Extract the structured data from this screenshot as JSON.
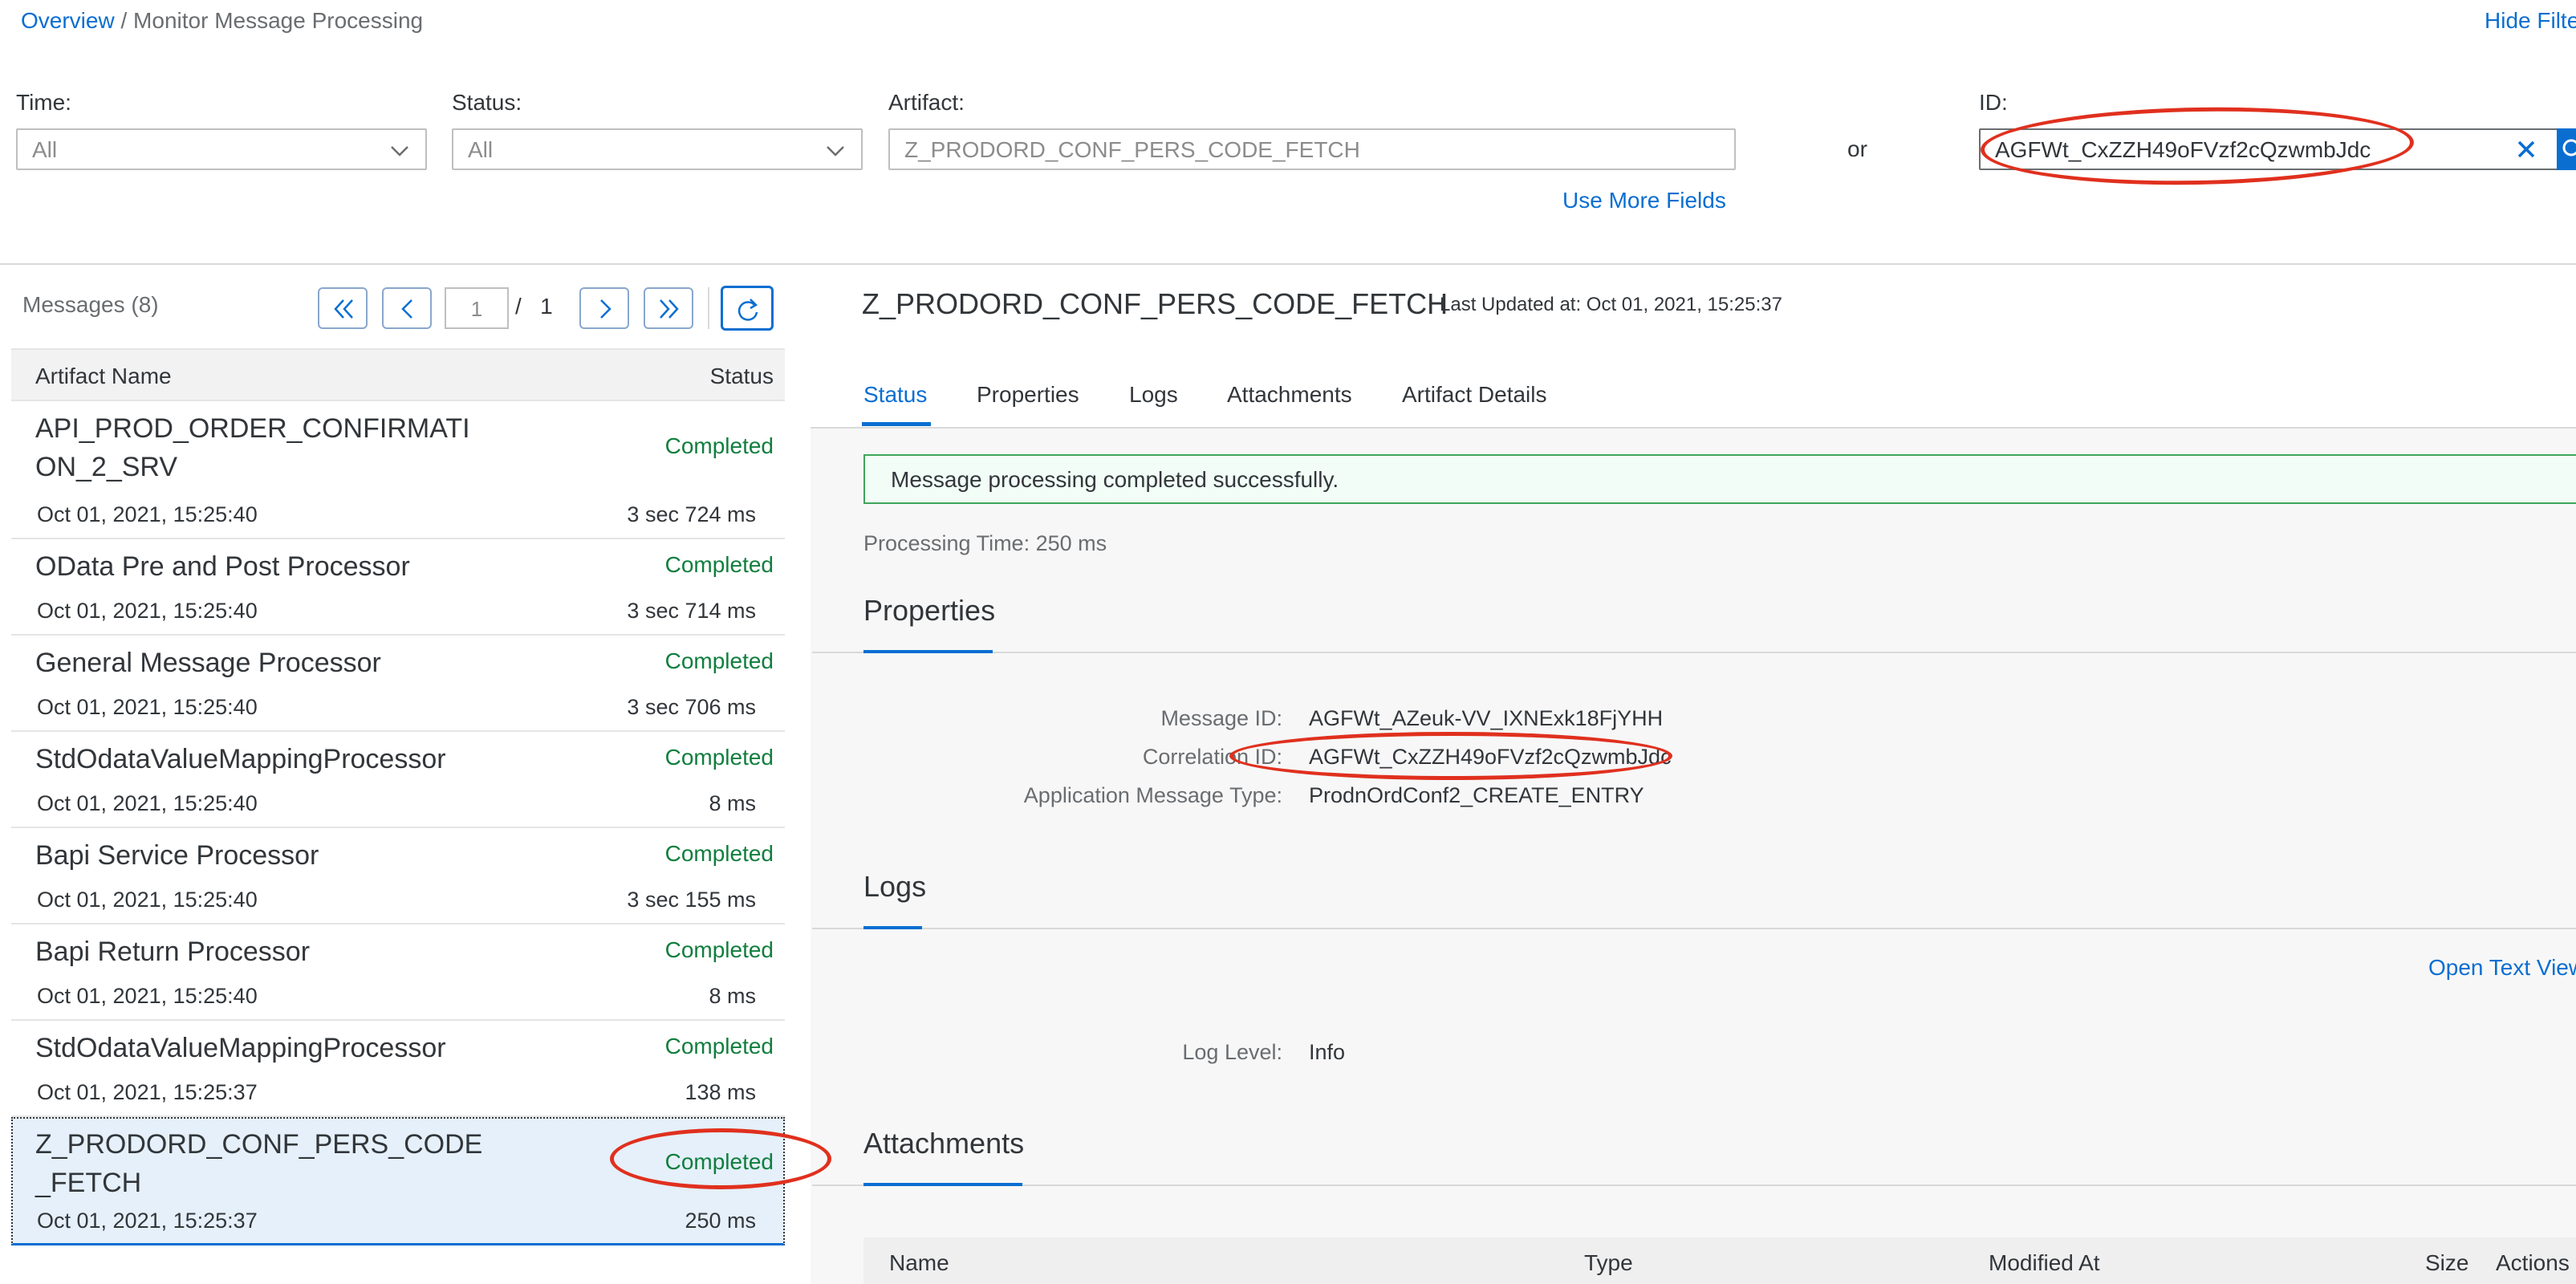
{
  "breadcrumb": {
    "overview": "Overview",
    "separator": " / ",
    "current": "Monitor Message Processing"
  },
  "hide_filter": "Hide Filte",
  "filters": {
    "time": {
      "label": "Time:",
      "value": "All"
    },
    "status": {
      "label": "Status:",
      "value": "All"
    },
    "artifact": {
      "label": "Artifact:",
      "placeholder": "Z_PRODORD_CONF_PERS_CODE_FETCH"
    },
    "or_text": "or",
    "id": {
      "label": "ID:",
      "value": "AGFWt_CxZZH49oFVzf2cQzwmbJdc"
    },
    "use_more_fields": "Use More Fields"
  },
  "messages": {
    "title": "Messages (8)",
    "page": "1",
    "page_sep": "/",
    "page_total": "1",
    "columns": {
      "name": "Artifact Name",
      "status": "Status"
    },
    "items": [
      {
        "name": "API_PROD_ORDER_CONFIRMATION_2_SRV",
        "status": "Completed",
        "date": "Oct 01, 2021, 15:25:40",
        "duration": "3 sec 724 ms"
      },
      {
        "name": "OData Pre and Post Processor",
        "status": "Completed",
        "date": "Oct 01, 2021, 15:25:40",
        "duration": "3 sec 714 ms"
      },
      {
        "name": "General Message Processor",
        "status": "Completed",
        "date": "Oct 01, 2021, 15:25:40",
        "duration": "3 sec 706 ms"
      },
      {
        "name": "StdOdataValueMappingProcessor",
        "status": "Completed",
        "date": "Oct 01, 2021, 15:25:40",
        "duration": "8 ms"
      },
      {
        "name": "Bapi Service Processor",
        "status": "Completed",
        "date": "Oct 01, 2021, 15:25:40",
        "duration": "3 sec 155 ms"
      },
      {
        "name": "Bapi Return Processor",
        "status": "Completed",
        "date": "Oct 01, 2021, 15:25:40",
        "duration": "8 ms"
      },
      {
        "name": "StdOdataValueMappingProcessor",
        "status": "Completed",
        "date": "Oct 01, 2021, 15:25:37",
        "duration": "138 ms"
      },
      {
        "name": "Z_PRODORD_CONF_PERS_CODE_FETCH",
        "status": "Completed",
        "date": "Oct 01, 2021, 15:25:37",
        "duration": "250 ms"
      }
    ]
  },
  "detail": {
    "title": "Z_PRODORD_CONF_PERS_CODE_FETCH",
    "last_updated": "Last Updated at: Oct 01, 2021, 15:25:37",
    "tabs": [
      "Status",
      "Properties",
      "Logs",
      "Attachments",
      "Artifact Details"
    ],
    "success_message": "Message processing completed successfully.",
    "processing_time": "Processing Time: 250 ms",
    "properties": {
      "title": "Properties",
      "message_id_label": "Message ID:",
      "message_id": "AGFWt_AZeuk-VV_IXNExk18FjYHH",
      "correlation_id_label": "Correlation ID:",
      "correlation_id": "AGFWt_CxZZH49oFVzf2cQzwmbJdc",
      "app_msg_type_label": "Application Message Type:",
      "app_msg_type": "ProdnOrdConf2_CREATE_ENTRY"
    },
    "logs": {
      "title": "Logs",
      "open_text_view": "Open Text View",
      "log_level_label": "Log Level:",
      "log_level": "Info"
    },
    "attachments": {
      "title": "Attachments",
      "columns": [
        "Name",
        "Type",
        "Modified At",
        "Size",
        "Actions"
      ]
    }
  },
  "colors": {
    "accent": "#0a6ed1",
    "success": "#107e3e",
    "annotation": "#e0301e"
  }
}
